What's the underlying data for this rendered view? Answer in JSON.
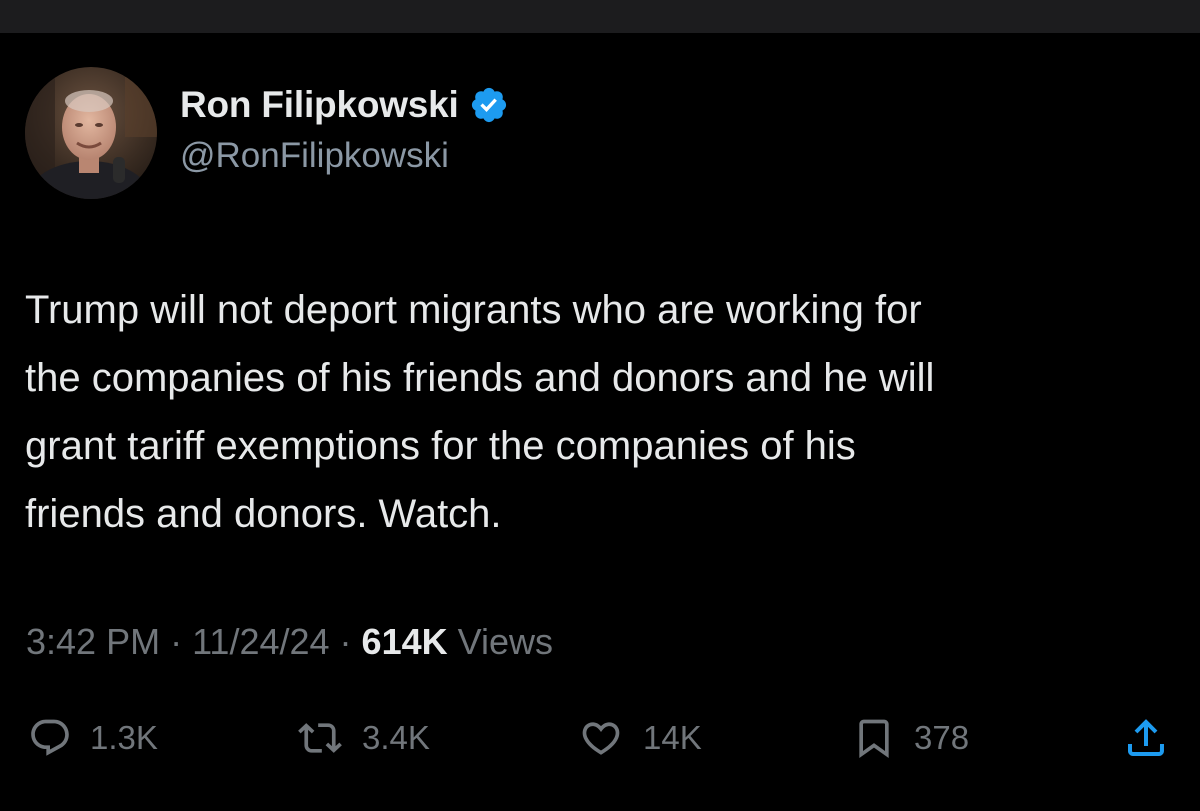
{
  "tweet": {
    "author": {
      "display_name": "Ron Filipkowski",
      "handle": "@RonFilipkowski",
      "verified": true
    },
    "text": "Trump will not deport migrants who are working for\nthe companies of his friends and donors and he will\ngrant tariff exemptions for the companies of his\nfriends and donors. Watch.",
    "meta": {
      "time": "3:42 PM",
      "separator": "·",
      "date": "11/24/24",
      "views_count": "614K",
      "views_label": "Views"
    },
    "actions": {
      "replies": "1.3K",
      "reposts": "3.4K",
      "likes": "14K",
      "bookmarks": "378"
    }
  },
  "colors": {
    "background": "#000000",
    "primary_text": "#e7e9ea",
    "secondary_text": "#71767b",
    "handle_text": "#8b98a5",
    "verified_badge": "#1d9bf0"
  },
  "icons": {
    "verified": "verified-badge-icon",
    "reply": "reply-icon",
    "repost": "repost-icon",
    "like": "heart-icon",
    "bookmark": "bookmark-icon",
    "share": "share-icon"
  }
}
